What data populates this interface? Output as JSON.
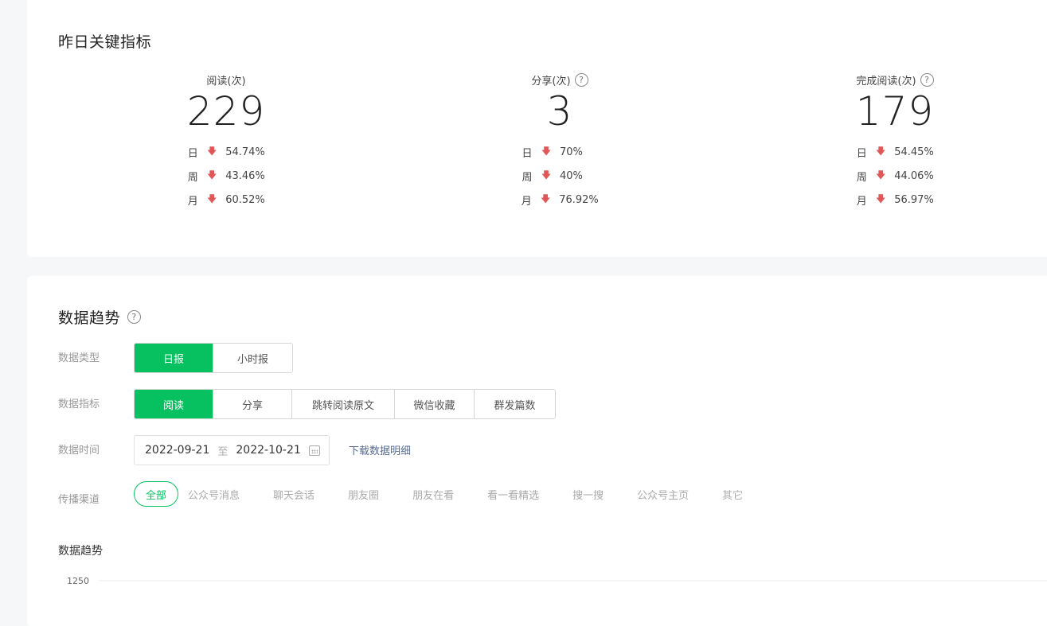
{
  "metrics_section": {
    "title": "昨日关键指标",
    "items": [
      {
        "label": "阅读(次)",
        "help": false,
        "value": "229",
        "rows": [
          {
            "period": "日",
            "arrow": "down",
            "pct": "54.74%"
          },
          {
            "period": "周",
            "arrow": "down",
            "pct": "43.46%"
          },
          {
            "period": "月",
            "arrow": "down",
            "pct": "60.52%"
          }
        ]
      },
      {
        "label": "分享(次)",
        "help": true,
        "value": "3",
        "rows": [
          {
            "period": "日",
            "arrow": "down",
            "pct": "70%"
          },
          {
            "period": "周",
            "arrow": "down",
            "pct": "40%"
          },
          {
            "period": "月",
            "arrow": "down",
            "pct": "76.92%"
          }
        ]
      },
      {
        "label": "完成阅读(次)",
        "help": true,
        "value": "179",
        "rows": [
          {
            "period": "日",
            "arrow": "down",
            "pct": "54.45%"
          },
          {
            "period": "周",
            "arrow": "down",
            "pct": "44.06%"
          },
          {
            "period": "月",
            "arrow": "down",
            "pct": "56.97%"
          }
        ]
      }
    ],
    "down_arrow_color": "#e15656"
  },
  "trend_section": {
    "title": "数据趋势",
    "help_glyph": "?",
    "data_type": {
      "label": "数据类型",
      "options": [
        "日报",
        "小时报"
      ],
      "selected": "日报"
    },
    "data_metric": {
      "label": "数据指标",
      "options": [
        "阅读",
        "分享",
        "跳转阅读原文",
        "微信收藏",
        "群发篇数"
      ],
      "selected": "阅读"
    },
    "data_time": {
      "label": "数据时间",
      "start": "2022-09-21",
      "separator": "至",
      "end": "2022-10-21",
      "download_label": "下载数据明细"
    },
    "channel": {
      "label": "传播渠道",
      "options": [
        "全部",
        "公众号消息",
        "聊天会话",
        "朋友圈",
        "朋友在看",
        "看一看精选",
        "搜一搜",
        "公众号主页",
        "其它"
      ],
      "selected": "全部"
    },
    "chart": {
      "title": "数据趋势"
    },
    "accent_color": "#07c160",
    "link_color": "#576b95"
  },
  "chart_data": {
    "type": "line",
    "title": "数据趋势",
    "y_tick_labels": [
      "1250"
    ],
    "series": []
  }
}
